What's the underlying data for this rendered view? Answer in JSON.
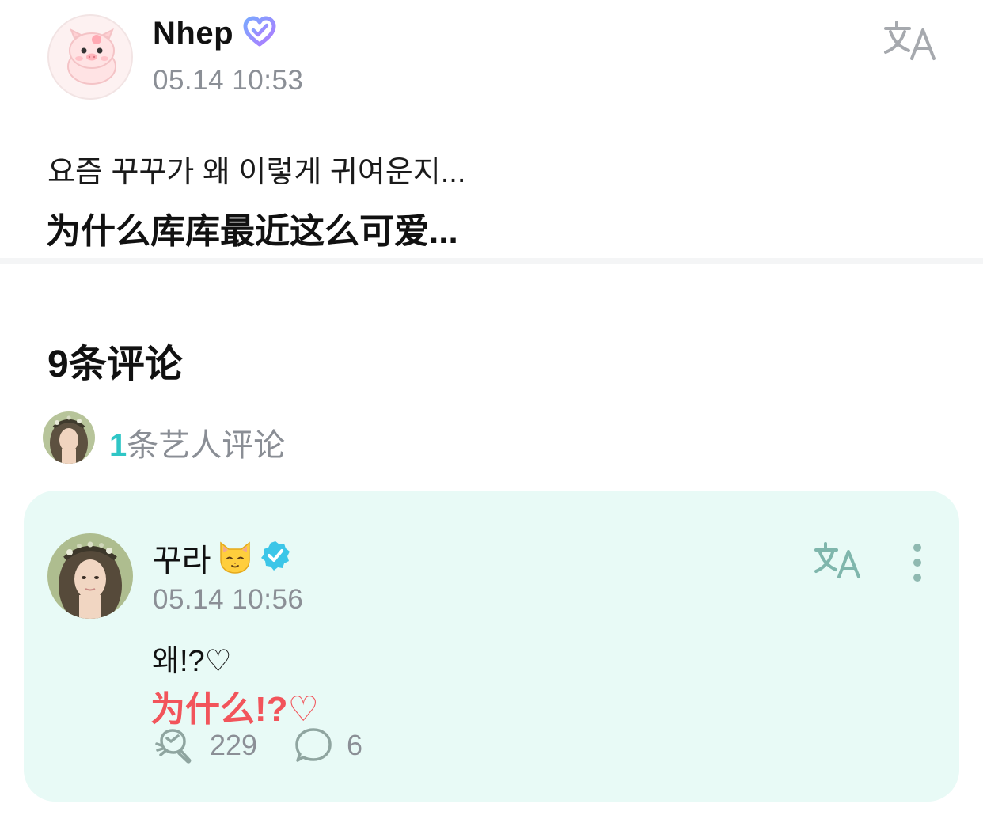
{
  "post": {
    "author": "Nhep",
    "time": "05.14 10:53",
    "text_ko": "요즘 꾸꾸가 왜 이렇게 귀여운지...",
    "text_zh": "为什么库库最近这么可爱..."
  },
  "comments_section": {
    "count_label": "9条评论",
    "artist_count": "1",
    "artist_label": "条艺人评论"
  },
  "artist_comment": {
    "name": "꾸라",
    "time": "05.14 10:56",
    "text_ko": "왜!?♡",
    "text_zh": "为什么!?♡",
    "likes": "229",
    "replies": "6"
  },
  "icons": {
    "verified_heart": "verified-heart-icon",
    "translate": "translate-icon",
    "cat_emoji": "cat-face-icon",
    "verified_check": "verified-badge-icon",
    "more": "more-vertical-icon",
    "like": "like-icon",
    "reply": "reply-bubble-icon"
  },
  "colors": {
    "accent_teal": "#2fc6c6",
    "card_background": "#e8faf6",
    "highlight_red": "#f2545b",
    "muted_text": "#8b8f96",
    "heart_gradient_start": "#7aa8ff",
    "heart_gradient_end": "#b07aff"
  }
}
